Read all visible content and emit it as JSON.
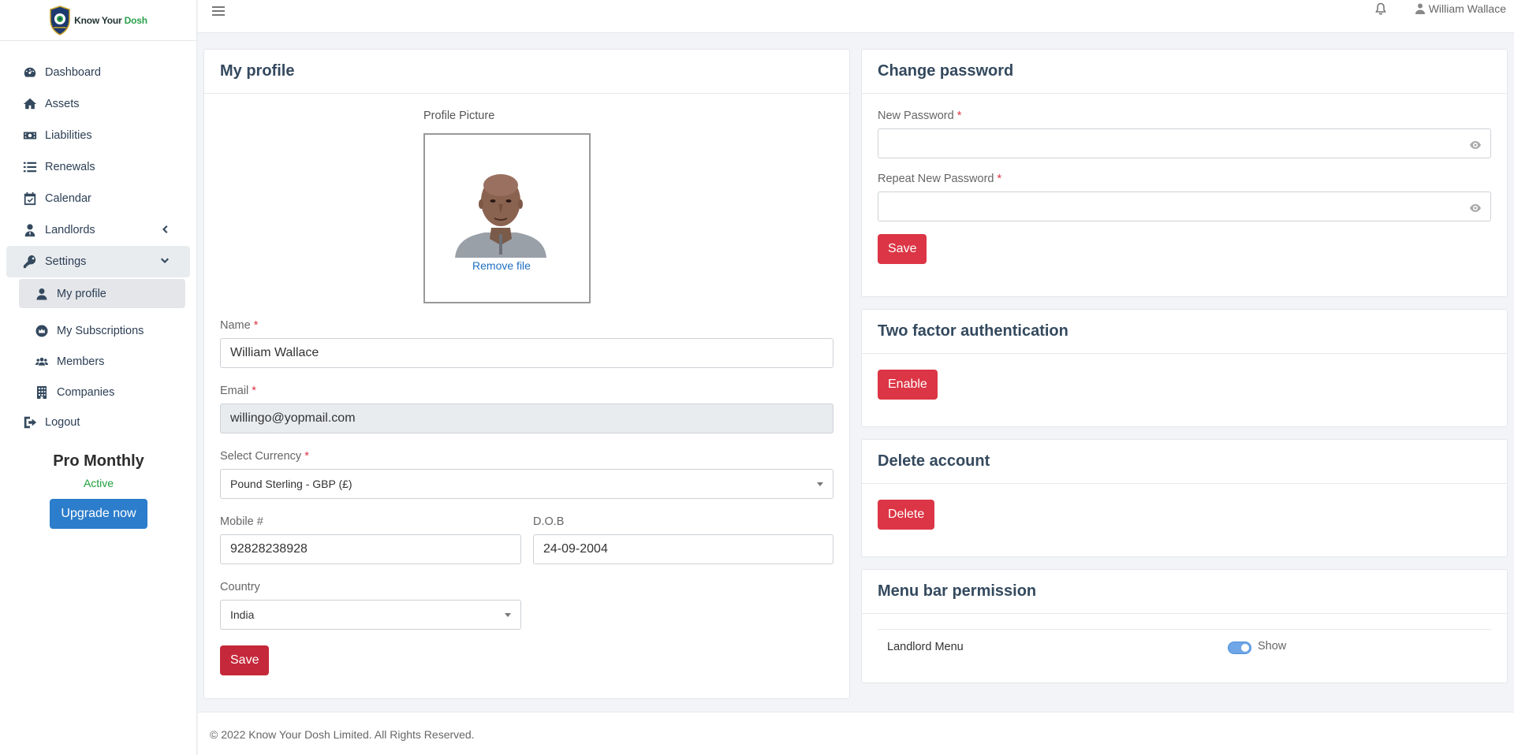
{
  "brand": {
    "name_part1": "Know Your ",
    "name_part2": "Dosh",
    "accent_color": "#2aa14b"
  },
  "sidebar": {
    "items": [
      {
        "label": "Dashboard",
        "icon": "gauge-icon"
      },
      {
        "label": "Assets",
        "icon": "home-icon"
      },
      {
        "label": "Liabilities",
        "icon": "money-bill-icon"
      },
      {
        "label": "Renewals",
        "icon": "list-icon"
      },
      {
        "label": "Calendar",
        "icon": "calendar-check-icon"
      },
      {
        "label": "Landlords",
        "icon": "user-tie-icon"
      },
      {
        "label": "Settings",
        "icon": "key-icon"
      },
      {
        "label": "Logout",
        "icon": "sign-out-icon"
      }
    ],
    "settings_sub": [
      {
        "label": "My profile",
        "icon": "user-icon"
      },
      {
        "label": "My Subscriptions",
        "icon": "crown-icon"
      },
      {
        "label": "Members",
        "icon": "users-icon"
      },
      {
        "label": "Companies",
        "icon": "building-icon"
      }
    ],
    "plan": {
      "name": "Pro Monthly",
      "status": "Active",
      "upgrade_label": "Upgrade now"
    }
  },
  "topbar": {
    "user_name": "William Wallace"
  },
  "profile": {
    "title": "My profile",
    "picture_label": "Profile Picture",
    "remove_label": "Remove file",
    "name_label": "Name",
    "name_value": "William Wallace",
    "email_label": "Email",
    "email_value": "willingo@yopmail.com",
    "currency_label": "Select Currency",
    "currency_value": "Pound Sterling - GBP (£)",
    "mobile_label": "Mobile #",
    "mobile_value": "92828238928",
    "dob_label": "D.O.B",
    "dob_value": "24-09-2004",
    "country_label": "Country",
    "country_value": "India",
    "save_label": "Save",
    "required_mark": "*"
  },
  "password": {
    "title": "Change password",
    "new_label": "New Password",
    "repeat_label": "Repeat New Password",
    "save_label": "Save"
  },
  "two_factor": {
    "title": "Two factor authentication",
    "enable_label": "Enable"
  },
  "delete_account": {
    "title": "Delete account",
    "delete_label": "Delete"
  },
  "menu_permission": {
    "title": "Menu bar permission",
    "row_label": "Landlord Menu",
    "toggle_label": "Show",
    "toggle_on": true
  },
  "footer": {
    "text": "© 2022 Know Your Dosh Limited. All Rights Reserved."
  },
  "colors": {
    "danger": "#dc3545",
    "primary": "#2c7dcb",
    "success": "#1e9e3c"
  }
}
